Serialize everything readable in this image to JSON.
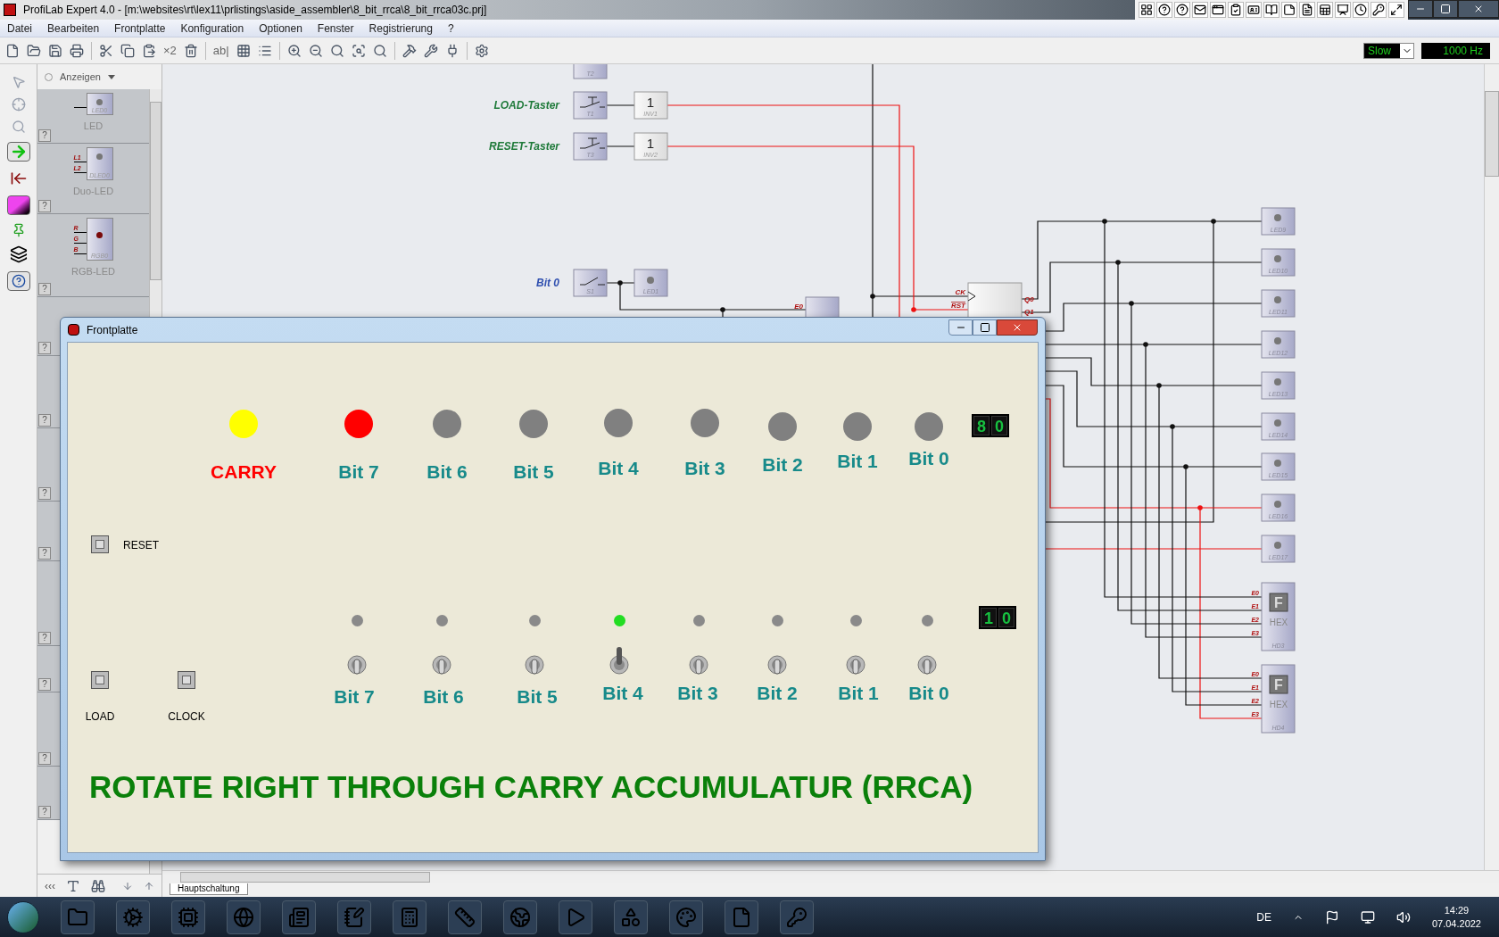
{
  "window": {
    "title": "ProfiLab Expert 4.0 - [m:\\websites\\rt\\lex11\\prlistings\\aside_assembler\\8_bit_rrca\\8_bit_rrca03c.prj]"
  },
  "menu": [
    "Datei",
    "Bearbeiten",
    "Frontplatte",
    "Konfiguration",
    "Optionen",
    "Fenster",
    "Registrierung",
    "?"
  ],
  "toolbar": {
    "multiply_label": "×2",
    "text_label": "ab|",
    "speed": "Slow",
    "frequency": "1000 Hz"
  },
  "palette": {
    "filter": {
      "label": "Anzeigen",
      "selected": false
    },
    "items": [
      {
        "kind": "led",
        "name": "LED",
        "tag": "LED0",
        "help": "?"
      },
      {
        "kind": "duo",
        "name": "Duo-LED",
        "tag": "DLED0",
        "pins": [
          "L1",
          "L2"
        ],
        "help": "?"
      },
      {
        "kind": "rgb",
        "name": "RGB-LED",
        "tag": "RGB0",
        "pins": [
          "R",
          "G",
          "B"
        ],
        "help": "?"
      },
      {
        "kind": "hidden",
        "help": "?"
      },
      {
        "kind": "hidden",
        "help": "?"
      },
      {
        "kind": "hidden",
        "help": "?"
      },
      {
        "kind": "hidden",
        "help": "?"
      },
      {
        "kind": "hidden",
        "help": "?"
      },
      {
        "kind": "hidden",
        "help": "?"
      },
      {
        "kind": "hidden",
        "help": "?"
      },
      {
        "kind": "hidden",
        "help": "?"
      }
    ],
    "collapse": "‹‹‹"
  },
  "canvas": {
    "clock_switch": "T2",
    "inputs": [
      {
        "kind": "button",
        "label": "LOAD-Taster",
        "color": "#1f7a3a",
        "switch": "T1",
        "gate": "1",
        "gate_tag": "INV1"
      },
      {
        "kind": "button",
        "label": "RESET-Taster",
        "color": "#1f7a3a",
        "switch": "T3",
        "gate": "1",
        "gate_tag": "INV2"
      },
      {
        "kind": "toggle",
        "label": "Bit 0",
        "color": "#3050b0",
        "switch": "S1",
        "led_tag": "LED1"
      }
    ],
    "mux_input": "E0",
    "register": {
      "inputs": [
        "CK",
        "RST"
      ],
      "outputs": [
        "Q0",
        "Q1"
      ]
    },
    "leds": [
      "LED9",
      "LED10",
      "LED11",
      "LED12",
      "LED13",
      "LED14",
      "LED15",
      "LED16",
      "LED17"
    ],
    "hex_displays": [
      {
        "digit": "F",
        "label": "HEX",
        "tag": "HD3",
        "inputs": [
          "E0",
          "E1",
          "E2",
          "E3"
        ]
      },
      {
        "digit": "F",
        "label": "HEX",
        "tag": "HD4",
        "inputs": [
          "E0",
          "E1",
          "E2",
          "E3"
        ]
      }
    ],
    "tab": "Hauptschaltung"
  },
  "front_panel": {
    "title": "Frontplatte",
    "outputs": [
      {
        "label": "CARRY",
        "color": "#ffff00"
      },
      {
        "label": "Bit 7",
        "color": "#ff0000"
      },
      {
        "label": "Bit 6",
        "color": "#808080"
      },
      {
        "label": "Bit 5",
        "color": "#808080"
      },
      {
        "label": "Bit 4",
        "color": "#808080"
      },
      {
        "label": "Bit 3",
        "color": "#808080"
      },
      {
        "label": "Bit 2",
        "color": "#808080"
      },
      {
        "label": "Bit 1",
        "color": "#808080"
      },
      {
        "label": "Bit 0",
        "color": "#808080"
      }
    ],
    "output_display": [
      "8",
      "0"
    ],
    "reset": "RESET",
    "inputs": [
      {
        "label": "Bit 7",
        "on": false
      },
      {
        "label": "Bit 6",
        "on": false
      },
      {
        "label": "Bit 5",
        "on": false
      },
      {
        "label": "Bit 4",
        "on": true
      },
      {
        "label": "Bit 3",
        "on": false
      },
      {
        "label": "Bit 2",
        "on": false
      },
      {
        "label": "Bit 1",
        "on": false
      },
      {
        "label": "Bit 0",
        "on": false
      }
    ],
    "input_display": [
      "1",
      "0"
    ],
    "buttons": [
      "LOAD",
      "CLOCK"
    ],
    "heading": "ROTATE RIGHT THROUGH CARRY ACCUMULATUR (RRCA)"
  },
  "taskbar": {
    "language": "DE",
    "time": "14:29",
    "date": "07.04.2022"
  }
}
